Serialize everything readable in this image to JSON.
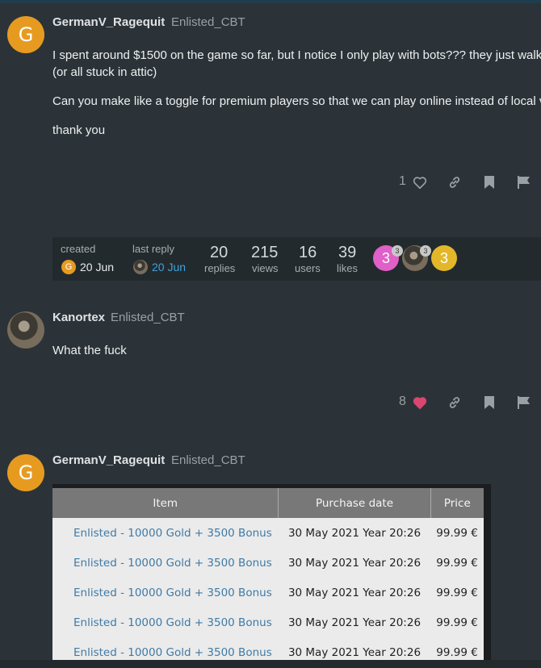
{
  "post1": {
    "avatar_letter": "G",
    "username": "GermanV_Ragequit",
    "user_title": "Enlisted_CBT",
    "paragraphs": [
      "I spent around $1500 on the game so far, but I notice I only play with bots??? they just walk",
      "(or all stuck in attic)",
      "Can you make like a toggle for premium players so that we can play online instead of local v",
      "thank you"
    ],
    "like_count": "1"
  },
  "topic_meta": {
    "created_label": "created",
    "created_value": "20 Jun",
    "last_reply_label": "last reply",
    "last_reply_value": "20 Jun",
    "stats": [
      {
        "value": "20",
        "label": "replies"
      },
      {
        "value": "215",
        "label": "views"
      },
      {
        "value": "16",
        "label": "users"
      },
      {
        "value": "39",
        "label": "likes"
      }
    ],
    "participants": [
      {
        "letter": "3",
        "badge": "3",
        "color": "#e060c8"
      },
      {
        "letter": "",
        "badge": "3",
        "color": "#3d3a33"
      },
      {
        "letter": "3",
        "badge": "",
        "color": "#e2b82a"
      }
    ],
    "created_avatar_letter": "G"
  },
  "post2": {
    "username": "Kanortex",
    "user_title": "Enlisted_CBT",
    "text": "What the fuck",
    "like_count": "8"
  },
  "post3": {
    "avatar_letter": "G",
    "username": "GermanV_Ragequit",
    "user_title": "Enlisted_CBT",
    "table": {
      "headers": [
        "Item",
        "Purchase date",
        "Price"
      ],
      "rows": [
        [
          "Enlisted - 10000 Gold + 3500 Bonus",
          "30 May 2021 Year 20:26",
          "99.99 €"
        ],
        [
          "Enlisted - 10000 Gold + 3500 Bonus",
          "30 May 2021 Year 20:26",
          "99.99 €"
        ],
        [
          "Enlisted - 10000 Gold + 3500 Bonus",
          "30 May 2021 Year 20:26",
          "99.99 €"
        ],
        [
          "Enlisted - 10000 Gold + 3500 Bonus",
          "30 May 2021 Year 20:26",
          "99.99 €"
        ],
        [
          "Enlisted - 10000 Gold + 3500 Bonus",
          "30 May 2021 Year 20:26",
          "99.99 €"
        ]
      ]
    }
  },
  "colors": {
    "background": "#2c3338",
    "avatar_orange": "#e69b20",
    "liked_heart": "#d9466f",
    "link_blue": "#3f7aa6"
  }
}
